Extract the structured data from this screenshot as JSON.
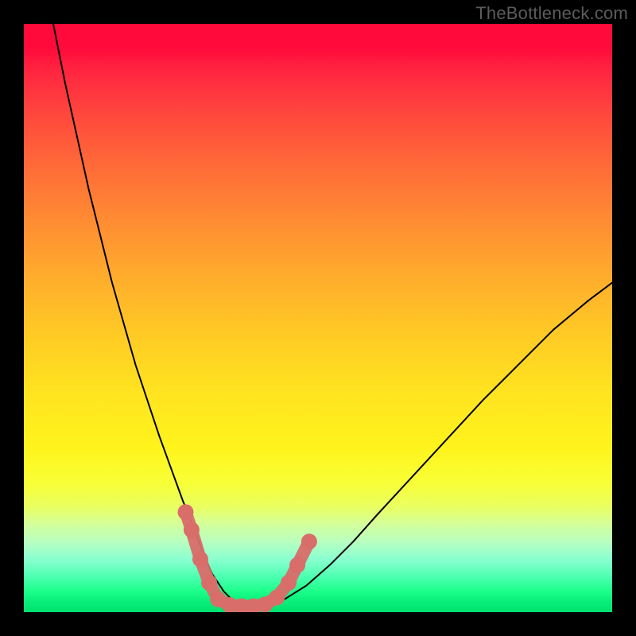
{
  "watermark": "TheBottleneck.com",
  "chart_data": {
    "type": "line",
    "title": "",
    "xlabel": "",
    "ylabel": "",
    "xlim": [
      0,
      100
    ],
    "ylim": [
      0,
      100
    ],
    "grid": false,
    "legend": false,
    "background_gradient": {
      "orientation": "vertical",
      "stops": [
        {
          "pos": 0.0,
          "color": "#ff0a3a"
        },
        {
          "pos": 0.16,
          "color": "#ff4a3d"
        },
        {
          "pos": 0.33,
          "color": "#ff8a33"
        },
        {
          "pos": 0.52,
          "color": "#ffc825"
        },
        {
          "pos": 0.72,
          "color": "#fff41c"
        },
        {
          "pos": 0.88,
          "color": "#b8ffc0"
        },
        {
          "pos": 1.0,
          "color": "#00e070"
        }
      ]
    },
    "series": [
      {
        "name": "bottleneck-curve",
        "color": "#000000",
        "x": [
          5,
          7,
          9,
          11,
          13,
          15,
          17,
          19,
          21,
          23,
          25,
          27,
          29,
          30.5,
          32,
          34,
          36,
          38,
          40,
          44,
          48,
          52,
          56,
          60,
          66,
          72,
          78,
          84,
          90,
          96,
          100
        ],
        "y": [
          100,
          90,
          81,
          72,
          64,
          56,
          49,
          42,
          36,
          30,
          24.5,
          19,
          14,
          10,
          6.5,
          3.5,
          1.5,
          0.5,
          0.5,
          2,
          4.5,
          8,
          12,
          16.5,
          23,
          29.5,
          36,
          42,
          48,
          53,
          56
        ]
      }
    ],
    "markers": {
      "name": "highlight-beads",
      "shape": "circle",
      "radius": 10,
      "fill": "#d96d6a",
      "stroke": "#d96d6a",
      "points": [
        {
          "x": 27.5,
          "y": 17
        },
        {
          "x": 28.5,
          "y": 14
        },
        {
          "x": 30.0,
          "y": 9
        },
        {
          "x": 31.5,
          "y": 5
        },
        {
          "x": 33.0,
          "y": 2.2
        },
        {
          "x": 35.0,
          "y": 1.2
        },
        {
          "x": 37.0,
          "y": 1.0
        },
        {
          "x": 39.0,
          "y": 1.0
        },
        {
          "x": 41.0,
          "y": 1.3
        },
        {
          "x": 43.0,
          "y": 2.5
        },
        {
          "x": 45.0,
          "y": 5.0
        },
        {
          "x": 46.5,
          "y": 8.0
        },
        {
          "x": 48.5,
          "y": 12.0
        }
      ]
    }
  }
}
